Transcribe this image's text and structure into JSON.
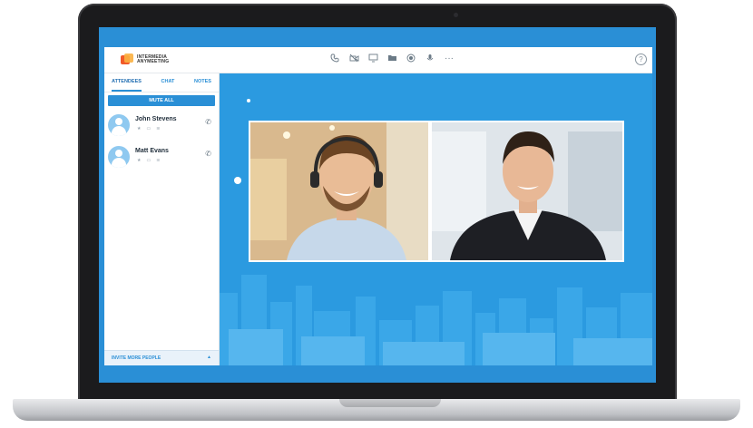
{
  "app": {
    "logo_line1": "INTERMEDIA",
    "logo_line2": "ANYMEETING"
  },
  "toolbar": {
    "icons": [
      "phone-icon",
      "video-camera-icon",
      "screen-share-icon",
      "folder-icon",
      "record-icon",
      "microphone-icon",
      "more-icon"
    ],
    "more_glyph": "···"
  },
  "sidebar": {
    "tabs": [
      {
        "label": "ATTENDEES",
        "active": true
      },
      {
        "label": "CHAT",
        "active": false
      },
      {
        "label": "NOTES",
        "active": false
      }
    ],
    "mute_all_label": "MUTE ALL",
    "attendees": [
      {
        "name": "John Stevens"
      },
      {
        "name": "Matt Evans"
      }
    ],
    "invite_label": "INVITE MORE PEOPLE",
    "invite_arrow": "▲"
  },
  "colors": {
    "accent": "#2a8fd6",
    "stage": "#2b9ae0",
    "logo_orange": "#f15a29",
    "logo_yellow": "#fbb040"
  }
}
